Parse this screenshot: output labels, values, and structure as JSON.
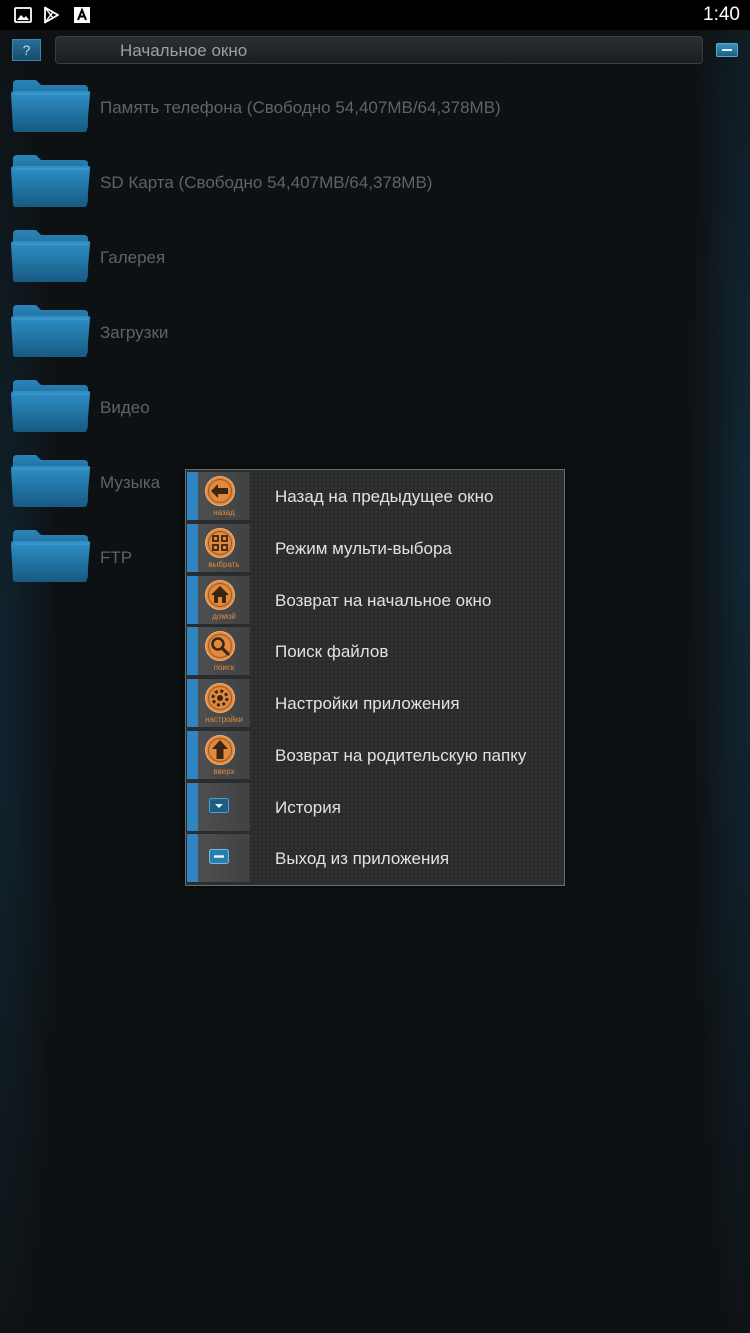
{
  "status_bar": {
    "time": "1:40",
    "icons": [
      "image-icon",
      "play-store-icon",
      "font-icon"
    ]
  },
  "title_bar": {
    "help_label": "?",
    "title": "Начальное окно"
  },
  "folders": [
    {
      "label": "Память телефона (Свободно 54,407MB/64,378MB)"
    },
    {
      "label": "SD Карта (Свободно 54,407MB/64,378MB)"
    },
    {
      "label": "Галерея"
    },
    {
      "label": "Загрузки"
    },
    {
      "label": "Видео"
    },
    {
      "label": "Музыка"
    },
    {
      "label": "FTP"
    }
  ],
  "menu": {
    "items": [
      {
        "label": "Назад на предыдущее окно",
        "caption": "назад",
        "icon": "back-arrow-icon"
      },
      {
        "label": "Режим мульти-выбора",
        "caption": "выбрать",
        "icon": "multi-select-icon"
      },
      {
        "label": "Возврат на начальное окно",
        "caption": "домой",
        "icon": "home-icon"
      },
      {
        "label": "Поиск файлов",
        "caption": "поиск",
        "icon": "search-icon"
      },
      {
        "label": "Настройки приложения",
        "caption": "настройки",
        "icon": "gear-icon"
      },
      {
        "label": "Возврат на родительскую папку",
        "caption": "вверх",
        "icon": "up-arrow-icon"
      },
      {
        "label": "История",
        "caption": "",
        "icon": "chevron-down-icon"
      },
      {
        "label": "Выход из приложения",
        "caption": "",
        "icon": "minus-icon"
      }
    ]
  },
  "colors": {
    "accent_blue": "#2f85c0",
    "icon_orange": "#e2893d",
    "folder_blue": "#1d6d9c"
  }
}
